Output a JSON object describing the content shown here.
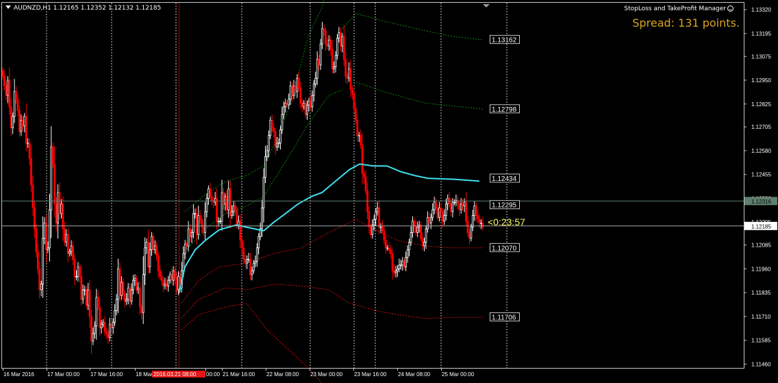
{
  "header": {
    "symbol_line": "AUDNZD,H1  1.12165 1.12352 1.12132 1.12185",
    "indicator_title": "StopLoss and TakeProfit Manager",
    "spread_text": "Spread: 131 points."
  },
  "colors": {
    "background": "#000000",
    "grid": "#c8c8c8",
    "bull_candle": "#ffffff",
    "bear_candle": "#ff0000",
    "ma_line": "#40e0f0",
    "upper_band": "#0f8a0f",
    "lower_band": "#d01010",
    "countdown": "#ffff66",
    "spread": "#daa520",
    "vertical_marker": "#b40000"
  },
  "chart_data": {
    "type": "candlestick",
    "symbol": "AUDNZD",
    "timeframe": "H1",
    "ohlc_last": {
      "open": 1.12165,
      "high": 1.12352,
      "low": 1.12132,
      "close": 1.12185
    },
    "ylim": [
      1.1144,
      1.1336
    ],
    "y_ticks": [
      "1.13320",
      "1.13195",
      "1.13075",
      "1.12950",
      "1.12825",
      "1.12705",
      "1.12580",
      "1.12455",
      "1.12330",
      "1.12205",
      "1.12085",
      "1.11960",
      "1.11835",
      "1.11710",
      "1.11585",
      "1.11460"
    ],
    "x_ticks": [
      "16 Mar 2016",
      "17 Mar 00:00",
      "17 Mar 16:00",
      "18 Mar",
      "00:00",
      "21 Mar 16:00",
      "22 Mar 08:00",
      "23 Mar 00:00",
      "23 Mar 16:00",
      "24 Mar 08:00",
      "25 Mar 00:00"
    ],
    "highlighted_time_label": "2016.03.21 08:00",
    "price_labels": [
      "1.13162",
      "1.12798",
      "1.12434",
      "1.12295",
      "1.12070",
      "1.11706"
    ],
    "current_price_tag": "1.12185",
    "ask_price_tag": "1.12316",
    "ask_price": 1.12316,
    "bid_price": 1.12185,
    "countdown": "<0:23:57",
    "closes": [
      1.1297,
      1.1292,
      1.1287,
      1.1295,
      1.1281,
      1.127,
      1.1276,
      1.1289,
      1.1285,
      1.1279,
      1.1268,
      1.1274,
      1.1271,
      1.1276,
      1.1262,
      1.1262,
      1.1254,
      1.124,
      1.1228,
      1.1217,
      1.1205,
      1.1196,
      1.1185,
      1.1188,
      1.1212,
      1.122,
      1.1206,
      1.1207,
      1.1227,
      1.126,
      1.1251,
      1.123,
      1.122,
      1.1236,
      1.1225,
      1.123,
      1.1217,
      1.121,
      1.1214,
      1.1204,
      1.1205,
      1.1208,
      1.1201,
      1.1192,
      1.1192,
      1.1197,
      1.1192,
      1.118,
      1.1185,
      1.1185,
      1.1177,
      1.1185,
      1.1171,
      1.1158,
      1.1162,
      1.1166,
      1.1181,
      1.1176,
      1.1165,
      1.1167,
      1.1168,
      1.1163,
      1.1162,
      1.116,
      1.1167,
      1.1165,
      1.1168,
      1.1174,
      1.118,
      1.1196,
      1.1182,
      1.1189,
      1.1183,
      1.1179,
      1.118,
      1.1186,
      1.1179,
      1.1185,
      1.119,
      1.1191,
      1.1185,
      1.1186,
      1.1176,
      1.1173,
      1.1193,
      1.1207,
      1.121,
      1.1197,
      1.1206,
      1.1213,
      1.1206,
      1.1208,
      1.1203,
      1.1195,
      1.1192,
      1.119,
      1.1187,
      1.1188,
      1.1187,
      1.119,
      1.1193,
      1.119,
      1.1195,
      1.1191,
      1.1185,
      1.1192,
      1.1186,
      1.1195,
      1.1204,
      1.1209,
      1.1208,
      1.1217,
      1.1213,
      1.1215,
      1.1225,
      1.1225,
      1.1214,
      1.1224,
      1.1222,
      1.1218,
      1.1215,
      1.1226,
      1.1233,
      1.1238,
      1.1234,
      1.1232,
      1.1231,
      1.1233,
      1.1221,
      1.1221,
      1.1221,
      1.1236,
      1.123,
      1.1234,
      1.1227,
      1.1238,
      1.1224,
      1.1226,
      1.1229,
      1.1227,
      1.1219,
      1.1221,
      1.1211,
      1.1207,
      1.1201,
      1.1199,
      1.1201,
      1.1201,
      1.1193,
      1.1195,
      1.1199,
      1.12,
      1.1207,
      1.1213,
      1.1217,
      1.1228,
      1.1244,
      1.1255,
      1.1258,
      1.1266,
      1.1274,
      1.127,
      1.1268,
      1.126,
      1.1262,
      1.1262,
      1.1269,
      1.1277,
      1.1281,
      1.1283,
      1.1282,
      1.1285,
      1.1292,
      1.1287,
      1.1292,
      1.1289,
      1.1296,
      1.1291,
      1.1283,
      1.1281,
      1.1283,
      1.1277,
      1.1282,
      1.1284,
      1.1281,
      1.1287,
      1.1293,
      1.1296,
      1.1306,
      1.1303,
      1.1314,
      1.1322,
      1.1321,
      1.1314,
      1.1313,
      1.1316,
      1.1311,
      1.1301,
      1.1302,
      1.1308,
      1.1317,
      1.132,
      1.1313,
      1.1318,
      1.1306,
      1.1297,
      1.1296,
      1.1301,
      1.129,
      1.1288,
      1.128,
      1.1274,
      1.1266,
      1.1266,
      1.1261,
      1.1246,
      1.1244,
      1.1237,
      1.1226,
      1.1218,
      1.1214,
      1.1219,
      1.1222,
      1.1226,
      1.1228,
      1.1218,
      1.1218,
      1.1216,
      1.1211,
      1.1207,
      1.1207,
      1.1206,
      1.1204,
      1.1195,
      1.1194,
      1.1195,
      1.1196,
      1.1198,
      1.1198,
      1.12,
      1.1197,
      1.1202,
      1.1206,
      1.121,
      1.1215,
      1.1221,
      1.1218,
      1.1215,
      1.1218,
      1.1219,
      1.1212,
      1.1208,
      1.121,
      1.1217,
      1.1223,
      1.122,
      1.1223,
      1.1227,
      1.1231,
      1.1228,
      1.1223,
      1.1228,
      1.1226,
      1.1221,
      1.1224,
      1.123,
      1.1233,
      1.123,
      1.1226,
      1.1231,
      1.1231,
      1.1232,
      1.123,
      1.1227,
      1.123,
      1.1229,
      1.1231,
      1.1221,
      1.1215,
      1.1212,
      1.1218,
      1.1224,
      1.1229,
      1.1224,
      1.1222,
      1.122,
      1.122,
      1.1218
    ],
    "ma": [
      [
        262,
        1.11835
      ],
      [
        270,
        1.1197
      ],
      [
        285,
        1.1206
      ],
      [
        300,
        1.1211
      ],
      [
        320,
        1.12165
      ],
      [
        345,
        1.1219
      ],
      [
        365,
        1.12175
      ],
      [
        385,
        1.1216
      ],
      [
        400,
        1.12205
      ],
      [
        415,
        1.12245
      ],
      [
        435,
        1.123
      ],
      [
        455,
        1.1234
      ],
      [
        470,
        1.1236
      ],
      [
        490,
        1.1242
      ],
      [
        510,
        1.1248
      ],
      [
        525,
        1.1251
      ],
      [
        545,
        1.125
      ],
      [
        565,
        1.125
      ],
      [
        585,
        1.1247
      ],
      [
        605,
        1.1245
      ],
      [
        625,
        1.12435
      ],
      [
        665,
        1.1243
      ],
      [
        700,
        1.1242
      ]
    ],
    "upper_bands": [
      [
        [
          270,
          1.1226
        ],
        [
          300,
          1.1235
        ],
        [
          330,
          1.1242
        ],
        [
          360,
          1.1245
        ],
        [
          385,
          1.125
        ],
        [
          410,
          1.1268
        ],
        [
          430,
          1.129
        ],
        [
          450,
          1.1318
        ],
        [
          470,
          1.1333
        ],
        [
          478,
          1.1345
        ]
      ],
      [
        [
          270,
          1.1205
        ],
        [
          300,
          1.1217
        ],
        [
          330,
          1.1225
        ],
        [
          360,
          1.1229
        ],
        [
          385,
          1.1234
        ],
        [
          420,
          1.1254
        ],
        [
          450,
          1.1272
        ],
        [
          480,
          1.1287
        ],
        [
          500,
          1.129
        ]
      ],
      [
        [
          500,
          1.1322
        ],
        [
          520,
          1.133
        ],
        [
          560,
          1.1326
        ],
        [
          620,
          1.1321
        ],
        [
          660,
          1.1318
        ],
        [
          705,
          1.13162
        ]
      ],
      [
        [
          520,
          1.1294
        ],
        [
          560,
          1.1289
        ],
        [
          620,
          1.1283
        ],
        [
          660,
          1.12815
        ],
        [
          705,
          1.12798
        ]
      ]
    ],
    "lower_bands": [
      [
        [
          265,
          1.1178
        ],
        [
          290,
          1.119
        ],
        [
          320,
          1.1197
        ],
        [
          360,
          1.1199
        ],
        [
          400,
          1.1204
        ],
        [
          440,
          1.1207
        ],
        [
          480,
          1.1215
        ],
        [
          520,
          1.1222
        ],
        [
          545,
          1.1217
        ],
        [
          580,
          1.1211
        ],
        [
          620,
          1.1208
        ],
        [
          660,
          1.1207
        ],
        [
          705,
          1.1207
        ]
      ],
      [
        [
          265,
          1.117
        ],
        [
          290,
          1.118
        ],
        [
          330,
          1.1186
        ],
        [
          360,
          1.1185
        ],
        [
          400,
          1.1188
        ],
        [
          440,
          1.1187
        ],
        [
          480,
          1.1185
        ],
        [
          510,
          1.1178
        ],
        [
          550,
          1.1174
        ],
        [
          580,
          1.1172
        ],
        [
          620,
          1.117
        ],
        [
          660,
          1.11705
        ],
        [
          705,
          1.11706
        ]
      ],
      [
        [
          265,
          1.1164
        ],
        [
          290,
          1.1172
        ],
        [
          330,
          1.1176
        ],
        [
          360,
          1.1178
        ],
        [
          390,
          1.1164
        ],
        [
          420,
          1.1154
        ],
        [
          450,
          1.1144
        ],
        [
          480,
          1.1132
        ]
      ]
    ]
  }
}
